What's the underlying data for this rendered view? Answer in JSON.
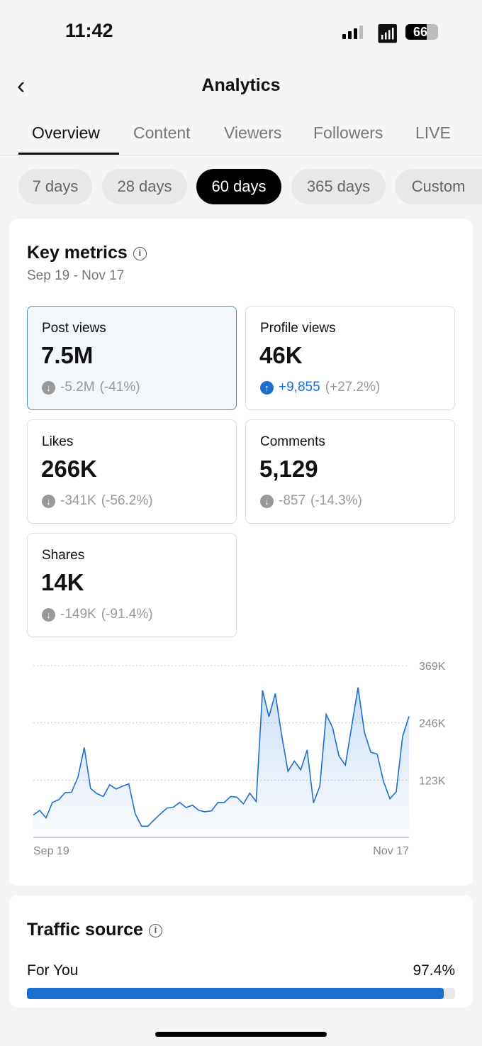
{
  "status_bar": {
    "time": "11:42",
    "battery": "66"
  },
  "header": {
    "title": "Analytics"
  },
  "tabs": [
    {
      "label": "Overview",
      "active": true
    },
    {
      "label": "Content"
    },
    {
      "label": "Viewers"
    },
    {
      "label": "Followers"
    },
    {
      "label": "LIVE"
    }
  ],
  "ranges": [
    {
      "label": "7 days"
    },
    {
      "label": "28 days"
    },
    {
      "label": "60 days",
      "active": true
    },
    {
      "label": "365 days"
    },
    {
      "label": "Custom"
    }
  ],
  "key_metrics": {
    "title": "Key metrics",
    "date_range": "Sep 19 - Nov 17",
    "metrics": [
      {
        "label": "Post views",
        "value": "7.5M",
        "change": "-5.2M",
        "pct": "(-41%)",
        "direction": "down",
        "selected": true
      },
      {
        "label": "Profile views",
        "value": "46K",
        "change": "+9,855",
        "pct": "(+27.2%)",
        "direction": "up"
      },
      {
        "label": "Likes",
        "value": "266K",
        "change": "-341K",
        "pct": "(-56.2%)",
        "direction": "down"
      },
      {
        "label": "Comments",
        "value": "5,129",
        "change": "-857",
        "pct": "(-14.3%)",
        "direction": "down"
      },
      {
        "label": "Shares",
        "value": "14K",
        "change": "-149K",
        "pct": "(-91.4%)",
        "direction": "down"
      }
    ]
  },
  "chart_data": {
    "type": "area",
    "x_start": "Sep 19",
    "x_end": "Nov 17",
    "ylim": [
      0,
      369000
    ],
    "yticks": [
      "123K",
      "246K",
      "369K"
    ],
    "ytick_values": [
      123000,
      246000,
      369000
    ],
    "grid": true,
    "color": "#1b6fd1",
    "values": [
      48000,
      58000,
      42000,
      75000,
      81000,
      96000,
      97000,
      129000,
      193000,
      105000,
      94000,
      88000,
      113000,
      104000,
      110000,
      115000,
      51000,
      24000,
      24000,
      38000,
      51000,
      63000,
      65000,
      75000,
      64000,
      69000,
      58000,
      55000,
      57000,
      75000,
      75000,
      88000,
      86000,
      72000,
      95000,
      77000,
      316000,
      259000,
      309000,
      220000,
      142000,
      164000,
      145000,
      188000,
      74000,
      110000,
      264000,
      236000,
      175000,
      155000,
      239000,
      322000,
      226000,
      183000,
      179000,
      120000,
      83000,
      98000,
      217000,
      260000
    ]
  },
  "traffic": {
    "title": "Traffic source",
    "items": [
      {
        "label": "For You",
        "value": "97.4%",
        "fraction": 0.974
      }
    ],
    "bar_color": "#1b6fd1"
  }
}
